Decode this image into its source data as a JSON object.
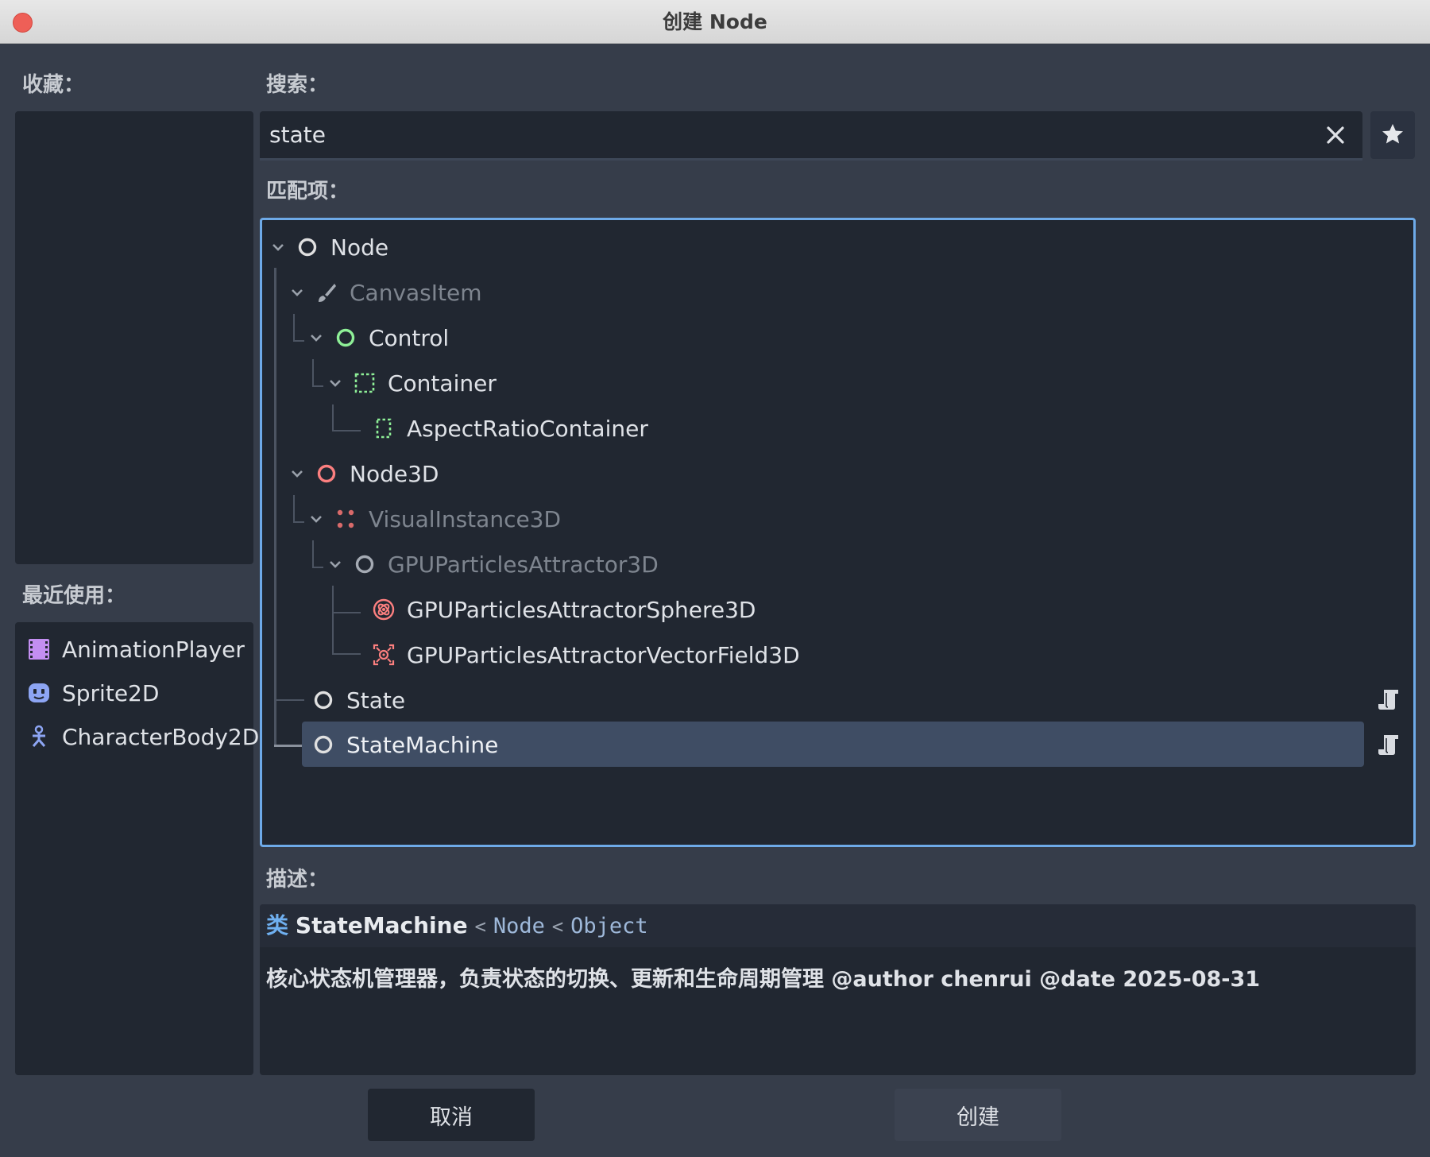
{
  "window": {
    "title": "创建 Node"
  },
  "favorites": {
    "label": "收藏："
  },
  "recent": {
    "label": "最近使用：",
    "items": [
      {
        "label": "AnimationPlayer",
        "icon": "animation-player-icon"
      },
      {
        "label": "Sprite2D",
        "icon": "sprite2d-icon"
      },
      {
        "label": "CharacterBody2D",
        "icon": "character-body2d-icon"
      }
    ]
  },
  "search": {
    "label": "搜索：",
    "value": "state"
  },
  "matches": {
    "label": "匹配项：",
    "items": [
      {
        "label": "Node",
        "icon": "node-icon"
      },
      {
        "label": "CanvasItem",
        "icon": "canvas-item-icon"
      },
      {
        "label": "Control",
        "icon": "control-icon"
      },
      {
        "label": "Container",
        "icon": "container-icon"
      },
      {
        "label": "AspectRatioContainer",
        "icon": "aspect-ratio-container-icon"
      },
      {
        "label": "Node3D",
        "icon": "node3d-icon"
      },
      {
        "label": "VisualInstance3D",
        "icon": "visual-instance3d-icon"
      },
      {
        "label": "GPUParticlesAttractor3D",
        "icon": "gpu-particles-attractor3d-icon"
      },
      {
        "label": "GPUParticlesAttractorSphere3D",
        "icon": "gpu-particles-attractor-sphere3d-icon"
      },
      {
        "label": "GPUParticlesAttractorVectorField3D",
        "icon": "gpu-particles-attractor-vector-field3d-icon"
      },
      {
        "label": "State",
        "icon": "node-icon"
      },
      {
        "label": "StateMachine",
        "icon": "node-icon"
      }
    ],
    "selected": "StateMachine"
  },
  "description": {
    "label": "描述：",
    "class_keyword": "类",
    "class_name": "StateMachine",
    "sep1": "<",
    "parent1": "Node",
    "sep2": "<",
    "parent2": "Object",
    "text": "核心状态机管理器，负责状态的切换、更新和生命周期管理 @author chenrui @date 2025-08-31"
  },
  "buttons": {
    "cancel": "取消",
    "create": "创建"
  },
  "colors": {
    "accent": "#6eaae8",
    "node_white": "#e0e0e0",
    "control_green": "#8eef97",
    "node3d_red": "#fc7f7f",
    "anim_purple": "#c38ef1",
    "sprite_blue": "#8da5f3"
  }
}
